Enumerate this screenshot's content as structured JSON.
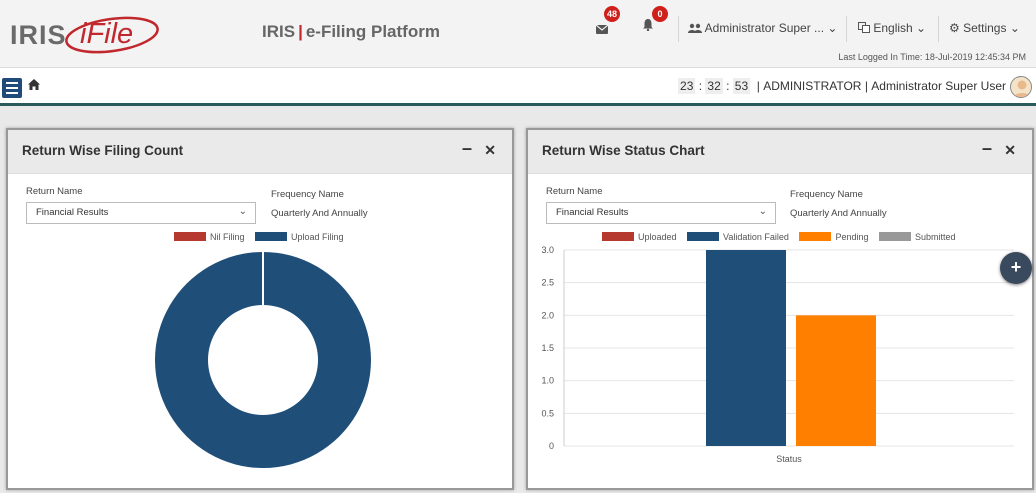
{
  "header": {
    "logo_iris": "IRIS",
    "logo_ifile": "iFile",
    "platform_iris": "IRIS",
    "platform_sep": "|",
    "platform_name": "e-Filing Platform",
    "messages_count": "48",
    "notifications_count": "0",
    "user_menu": "Administrator Super ...",
    "language": "English",
    "settings": "Settings",
    "last_logged": "Last Logged In Time: 18-Jul-2019 12:45:34 PM"
  },
  "navbar": {
    "time_h": "23",
    "time_m": "32",
    "time_s": "53",
    "role": "ADMINISTRATOR",
    "user": "Administrator Super User"
  },
  "panels": {
    "left": {
      "title": "Return Wise Filing Count",
      "return_label": "Return Name",
      "return_value": "Financial Results",
      "freq_label": "Frequency Name",
      "freq_value": "Quarterly And Annually"
    },
    "right": {
      "title": "Return Wise Status Chart",
      "return_label": "Return Name",
      "return_value": "Financial Results",
      "freq_label": "Frequency Name",
      "freq_value": "Quarterly And Annually"
    }
  },
  "icons": [
    "envelope-icon",
    "bell-icon",
    "users-icon",
    "language-icon",
    "gear-icon",
    "menu-icon",
    "home-icon",
    "user-avatar-icon",
    "plus-icon",
    "chevron-down-icon",
    "minimize-icon",
    "close-icon"
  ],
  "colors": {
    "dark_blue": "#1f4e79",
    "red": "#b5392e",
    "orange": "#ff8000",
    "gray": "#999999",
    "badge": "#d0201c"
  },
  "chart_data": [
    {
      "type": "pie",
      "series": [
        {
          "name": "Nil Filing",
          "value": 0,
          "color": "#b5392e"
        },
        {
          "name": "Upload Filing",
          "value": 1,
          "color": "#1f4e79"
        }
      ],
      "legend_position": "top"
    },
    {
      "type": "bar",
      "categories": [
        "Status"
      ],
      "series": [
        {
          "name": "Uploaded",
          "values": [
            0
          ],
          "color": "#b5392e"
        },
        {
          "name": "Validation Failed",
          "values": [
            3
          ],
          "color": "#1f4e79"
        },
        {
          "name": "Pending",
          "values": [
            2
          ],
          "color": "#ff8000"
        },
        {
          "name": "Submitted",
          "values": [
            0
          ],
          "color": "#999999"
        }
      ],
      "yticks": [
        "3.0",
        "2.5",
        "2.0",
        "1.5",
        "1.0",
        "0.5",
        "0"
      ],
      "ylim": [
        0,
        3
      ],
      "grid": true,
      "legend_position": "top"
    }
  ]
}
